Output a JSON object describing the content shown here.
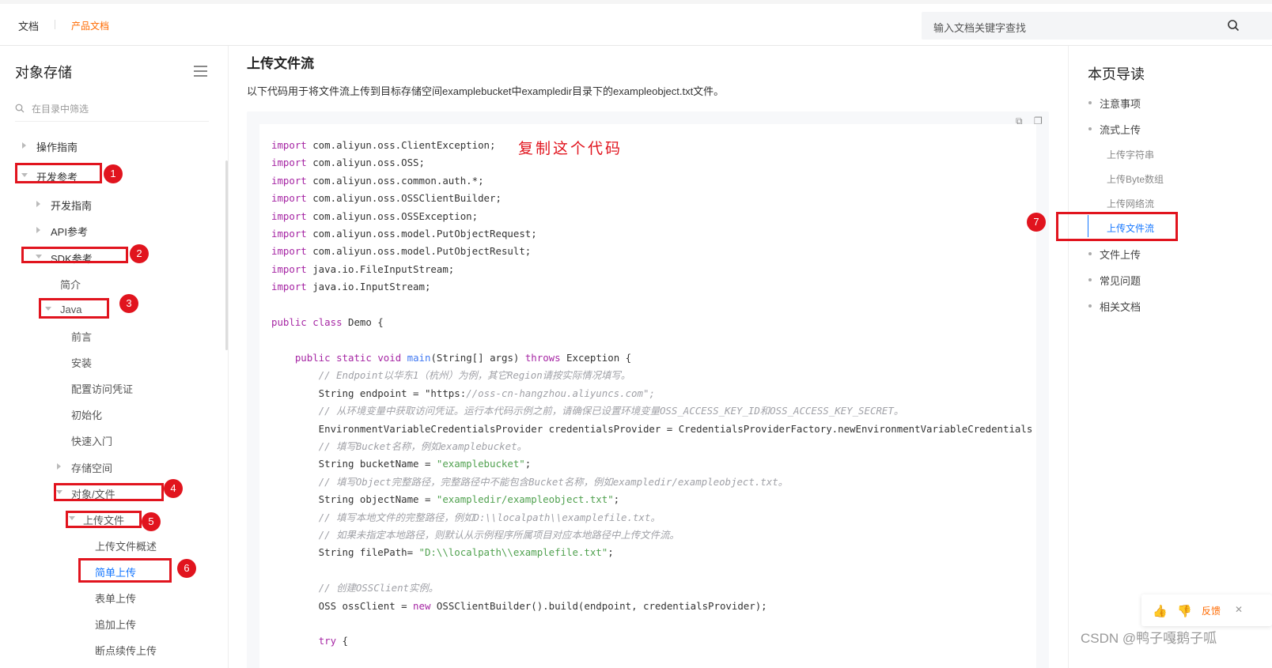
{
  "topbar": {
    "brand": "文档",
    "product_docs": "产品文档",
    "search_placeholder": "输入文档关键字查找"
  },
  "sidebar": {
    "title": "对象存储",
    "filter_placeholder": "在目录中筛选",
    "items": [
      {
        "label": "操作指南"
      },
      {
        "label": "开发参考"
      },
      {
        "label": "开发指南"
      },
      {
        "label": "API参考"
      },
      {
        "label": "SDK参考"
      },
      {
        "label": "简介"
      },
      {
        "label": "Java"
      },
      {
        "label": "前言"
      },
      {
        "label": "安装"
      },
      {
        "label": "配置访问凭证"
      },
      {
        "label": "初始化"
      },
      {
        "label": "快速入门"
      },
      {
        "label": "存储空间"
      },
      {
        "label": "对象/文件"
      },
      {
        "label": "上传文件"
      },
      {
        "label": "上传文件概述"
      },
      {
        "label": "简单上传"
      },
      {
        "label": "表单上传"
      },
      {
        "label": "追加上传"
      },
      {
        "label": "断点续传上传"
      }
    ]
  },
  "badges": [
    "1",
    "2",
    "3",
    "4",
    "5",
    "6",
    "7"
  ],
  "main": {
    "title": "上传文件流",
    "description": "以下代码用于将文件流上传到目标存储空间examplebucket中exampledir目录下的exampleobject.txt文件。",
    "annotation": "复制这个代码",
    "code_lines": [
      "import com.aliyun.oss.ClientException;",
      "import com.aliyun.oss.OSS;",
      "import com.aliyun.oss.common.auth.*;",
      "import com.aliyun.oss.OSSClientBuilder;",
      "import com.aliyun.oss.OSSException;",
      "import com.aliyun.oss.model.PutObjectRequest;",
      "import com.aliyun.oss.model.PutObjectResult;",
      "import java.io.FileInputStream;",
      "import java.io.InputStream;",
      "",
      "public class Demo {",
      "",
      "    public static void main(String[] args) throws Exception {",
      "        // Endpoint以华东1（杭州）为例，其它Region请按实际情况填写。",
      "        String endpoint = \"https://oss-cn-hangzhou.aliyuncs.com\";",
      "        // 从环境变量中获取访问凭证。运行本代码示例之前，请确保已设置环境变量OSS_ACCESS_KEY_ID和OSS_ACCESS_KEY_SECRET。",
      "        EnvironmentVariableCredentialsProvider credentialsProvider = CredentialsProviderFactory.newEnvironmentVariableCredentials",
      "        // 填写Bucket名称，例如examplebucket。",
      "        String bucketName = \"examplebucket\";",
      "        // 填写Object完整路径，完整路径中不能包含Bucket名称，例如exampledir/exampleobject.txt。",
      "        String objectName = \"exampledir/exampleobject.txt\";",
      "        // 填写本地文件的完整路径，例如D:\\\\localpath\\\\examplefile.txt。",
      "        // 如果未指定本地路径，则默认从示例程序所属项目对应本地路径中上传文件流。",
      "        String filePath= \"D:\\\\localpath\\\\examplefile.txt\";",
      "",
      "        // 创建OSSClient实例。",
      "        OSS ossClient = new OSSClientBuilder().build(endpoint, credentialsProvider);",
      "",
      "        try {"
    ]
  },
  "toc": {
    "title": "本页导读",
    "items": [
      "注意事项",
      "流式上传",
      "上传字符串",
      "上传Byte数组",
      "上传网络流",
      "上传文件流",
      "文件上传",
      "常见问题",
      "相关文档"
    ]
  },
  "feedback": {
    "label": "反馈"
  },
  "watermark": "CSDN @鸭子嘎鹅子呱",
  "colors": {
    "accent": "#1677ff",
    "brand": "#ff6a00",
    "annotation_red": "#e1141e"
  }
}
